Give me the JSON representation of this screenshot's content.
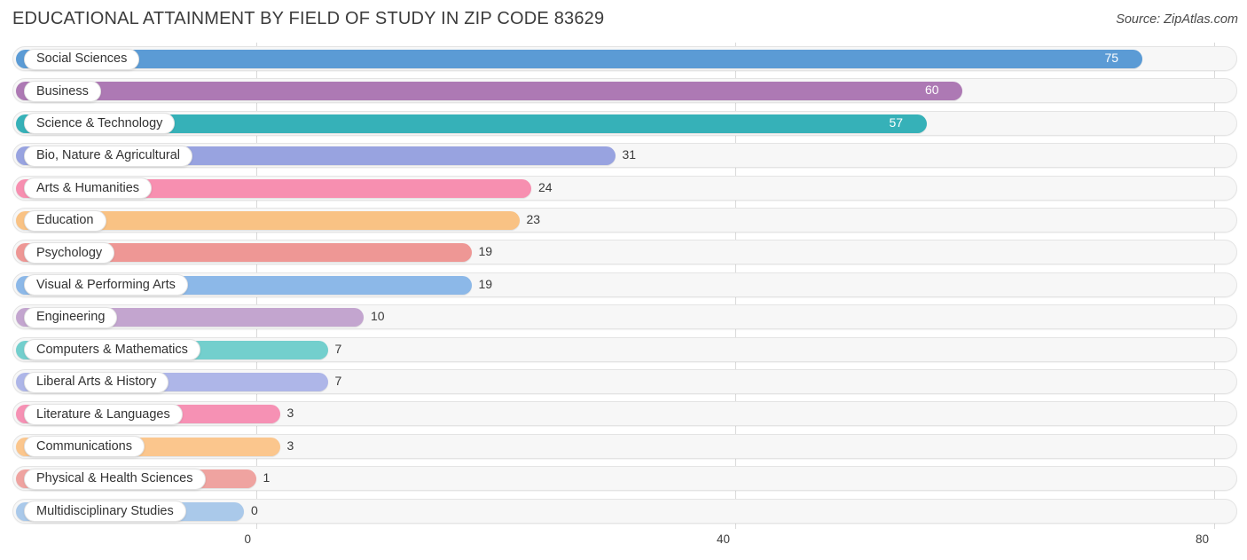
{
  "header": {
    "title": "EDUCATIONAL ATTAINMENT BY FIELD OF STUDY IN ZIP CODE 83629",
    "source": "Source: ZipAtlas.com"
  },
  "chart_data": {
    "type": "bar",
    "orientation": "horizontal",
    "title": "EDUCATIONAL ATTAINMENT BY FIELD OF STUDY IN ZIP CODE 83629",
    "xlabel": "",
    "ylabel": "",
    "xlim": [
      0,
      80
    ],
    "xticks": [
      0,
      40,
      80
    ],
    "xtick_labels": [
      "0",
      "40",
      "80"
    ],
    "grid": true,
    "legend": false,
    "categories": [
      "Social Sciences",
      "Business",
      "Science & Technology",
      "Bio, Nature & Agricultural",
      "Arts & Humanities",
      "Education",
      "Psychology",
      "Visual & Performing Arts",
      "Engineering",
      "Computers & Mathematics",
      "Liberal Arts & History",
      "Literature & Languages",
      "Communications",
      "Physical & Health Sciences",
      "Multidisciplinary Studies"
    ],
    "values": [
      75,
      60,
      57,
      31,
      24,
      23,
      19,
      19,
      10,
      7,
      7,
      3,
      3,
      1,
      0
    ],
    "value_labels": [
      "75",
      "60",
      "57",
      "31",
      "24",
      "23",
      "19",
      "19",
      "10",
      "7",
      "7",
      "3",
      "3",
      "1",
      "0"
    ],
    "colors": [
      "#5b9bd5",
      "#ad79b4",
      "#36b1b8",
      "#98a3e0",
      "#f78fb0",
      "#f9c284",
      "#ee9795",
      "#8cb8e8",
      "#c3a5cf",
      "#73cfcd",
      "#aeb6e8",
      "#f691b4",
      "#fbc68d",
      "#efa3a0",
      "#aac9ea"
    ]
  }
}
